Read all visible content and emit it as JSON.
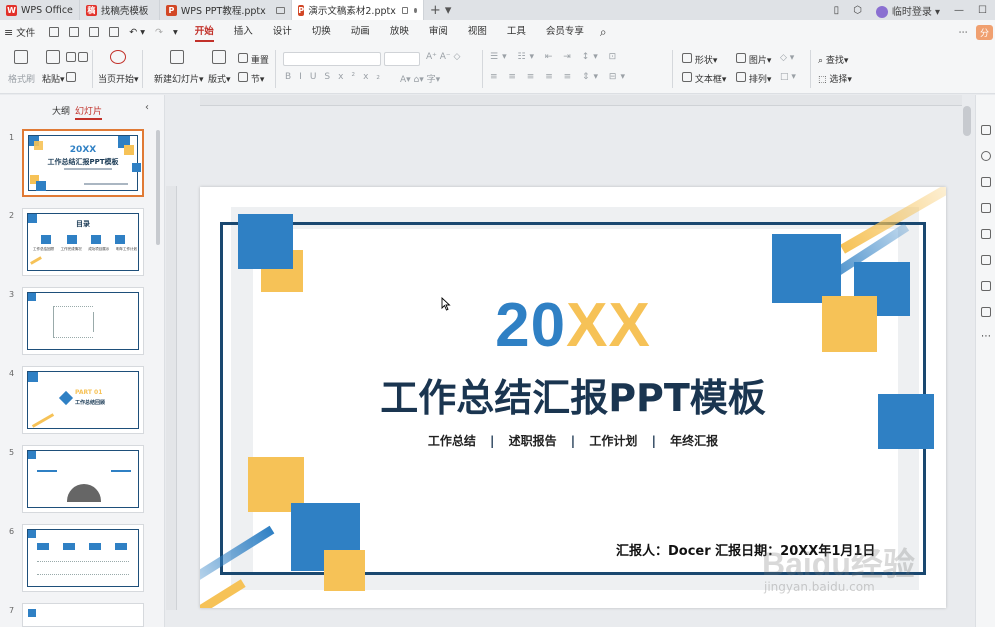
{
  "tabs": [
    {
      "label": "WPS Office",
      "logo": "W",
      "color": "#e2312a"
    },
    {
      "label": "找稿壳模板",
      "logo": "稿",
      "color": "#e2312a"
    },
    {
      "label": "WPS PPT教程.pptx",
      "logo": "P",
      "color": "#d24726"
    },
    {
      "label": "演示文稿素材2.pptx",
      "logo": "P",
      "color": "#d24726"
    }
  ],
  "window": {
    "user": "临时登录"
  },
  "menu": {
    "file": "文件",
    "items": [
      "开始",
      "插入",
      "设计",
      "切换",
      "动画",
      "放映",
      "审阅",
      "视图",
      "工具",
      "会员专享"
    ],
    "active": "开始"
  },
  "ribbon": {
    "format_painter": "格式刷",
    "paste": "粘贴",
    "play_from_current": "当页开始",
    "new_slide": "新建幻灯片",
    "layout": "版式",
    "section": "节",
    "reset": "重置",
    "shape": "形状",
    "image": "图片",
    "textbox": "文本框",
    "arrange": "排列",
    "find": "查找",
    "select": "选择"
  },
  "left_panel": {
    "tab_outline": "大纲",
    "tab_slides": "幻灯片",
    "slide_numbers": [
      "1",
      "2",
      "3",
      "4",
      "5",
      "6",
      "7"
    ],
    "thumb1_year": "20XX",
    "thumb1_title": "工作总结汇报PPT模板",
    "thumb2_title": "目录",
    "thumb2_items": [
      "工作总结回顾",
      "工作完成情况",
      "成功项目展示",
      "明年工作计划"
    ],
    "thumb4_part": "PART 01",
    "thumb4_sub": "工作总结回顾"
  },
  "slide": {
    "year_a": "20",
    "year_b": "XX",
    "title": "工作总结汇报PPT模板",
    "subtitles": [
      "工作总结",
      "述职报告",
      "工作计划",
      "年终汇报"
    ],
    "reporter": "汇报人：Docer  汇报日期：20XX年1月1日"
  },
  "watermark": {
    "text1": "Baidu",
    "text2": "经验",
    "url": "jingyan.baidu.com"
  },
  "colors": {
    "blue": "#2f80c4",
    "navy": "#1a4870",
    "yellow": "#f6c257",
    "accent": "#c2312a"
  }
}
